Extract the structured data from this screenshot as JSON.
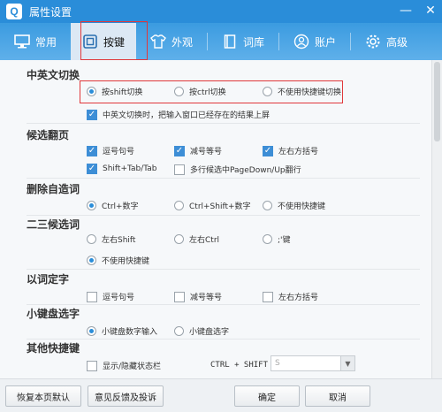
{
  "window": {
    "logo_text": "Q",
    "title": "属性设置",
    "minimize": "—",
    "close": "✕"
  },
  "tabs": [
    {
      "label": "常用",
      "icon": "monitor-icon"
    },
    {
      "label": "按键",
      "icon": "keyboard-icon",
      "active": true
    },
    {
      "label": "外观",
      "icon": "shirt-icon"
    },
    {
      "label": "词库",
      "icon": "book-icon"
    },
    {
      "label": "账户",
      "icon": "user-icon"
    },
    {
      "label": "高级",
      "icon": "gear-icon"
    }
  ],
  "sections": {
    "cn_en_switch": {
      "title": "中英文切换",
      "options": [
        "按shift切换",
        "按ctrl切换",
        "不使用快捷键切换"
      ],
      "selected": 0,
      "commit_check": "中英文切换时，把输入窗口已经存在的结果上屏"
    },
    "paging": {
      "title": "候选翻页",
      "checks": [
        "逗号句号",
        "减号等号",
        "左右方括号",
        "Shift+Tab/Tab",
        "多行候选中PageDown/Up翻行"
      ],
      "checked": [
        true,
        true,
        true,
        true,
        false
      ]
    },
    "delete_word": {
      "title": "删除自造词",
      "options": [
        "Ctrl+数字",
        "Ctrl+Shift+数字",
        "不使用快捷键"
      ],
      "selected": 0
    },
    "second_third": {
      "title": "二三候选词",
      "options": [
        "左右Shift",
        "左右Ctrl",
        ";'键",
        "不使用快捷键"
      ],
      "selected": 3
    },
    "word_pick": {
      "title": "以词定字",
      "checks": [
        "逗号句号",
        "减号等号",
        "左右方括号"
      ],
      "checked": [
        false,
        false,
        false
      ]
    },
    "numpad_pick": {
      "title": "小键盘选字",
      "options": [
        "小键盘数字输入",
        "小键盘选字"
      ],
      "selected": 0
    },
    "other_hotkeys": {
      "title": "其他快捷键",
      "status_check": "显示/隐藏状态栏",
      "status_checked": false,
      "hotkey_label": "CTRL + SHIFT +",
      "hotkey_value": "S"
    }
  },
  "footer": {
    "restore": "恢复本页默认",
    "feedback": "意见反馈及投诉",
    "ok": "确定",
    "cancel": "取消"
  },
  "colors": {
    "accent": "#2a8dd9",
    "highlight_box": "#e0383b",
    "check_fill": "#3d8ed6"
  }
}
